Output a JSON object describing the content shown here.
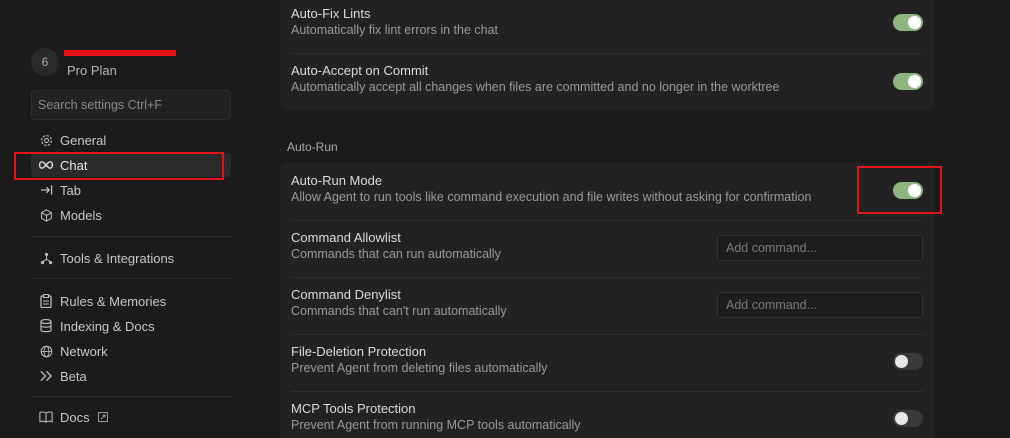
{
  "profile": {
    "avatar_initial": "6",
    "name": "",
    "plan": "Pro Plan"
  },
  "search": {
    "placeholder": "Search settings Ctrl+F"
  },
  "sidebar": {
    "items": [
      {
        "label": "General",
        "icon": "gear-icon"
      },
      {
        "label": "Chat",
        "icon": "infinity-icon",
        "active": true
      },
      {
        "label": "Tab",
        "icon": "tab-arrow-icon"
      },
      {
        "label": "Models",
        "icon": "cube-icon"
      },
      {
        "label": "Tools & Integrations",
        "icon": "tools-icon"
      },
      {
        "label": "Rules & Memories",
        "icon": "clipboard-icon"
      },
      {
        "label": "Indexing & Docs",
        "icon": "database-icon"
      },
      {
        "label": "Network",
        "icon": "globe-icon"
      },
      {
        "label": "Beta",
        "icon": "double-chevron-icon"
      },
      {
        "label": "Docs",
        "icon": "book-icon"
      }
    ]
  },
  "top_card": {
    "rows": [
      {
        "title": "Auto-Fix Lints",
        "desc": "Automatically fix lint errors in the chat",
        "toggle": "on"
      },
      {
        "title": "Auto-Accept on Commit",
        "desc": "Automatically accept all changes when files are committed and no longer in the worktree",
        "toggle": "on"
      }
    ]
  },
  "auto_run": {
    "section_label": "Auto-Run",
    "rows": [
      {
        "title": "Auto-Run Mode",
        "desc": "Allow Agent to run tools like command execution and file writes without asking for confirmation",
        "toggle": "on"
      },
      {
        "title": "Command Allowlist",
        "desc": "Commands that can run automatically",
        "input_placeholder": "Add command..."
      },
      {
        "title": "Command Denylist",
        "desc": "Commands that can't run automatically",
        "input_placeholder": "Add command..."
      },
      {
        "title": "File-Deletion Protection",
        "desc": "Prevent Agent from deleting files automatically",
        "toggle": "off"
      },
      {
        "title": "MCP Tools Protection",
        "desc": "Prevent Agent from running MCP tools automatically",
        "toggle": "off"
      }
    ]
  },
  "colors": {
    "toggle_on": "#8fb680",
    "highlight": "#e3141c",
    "background": "#1b1b1b",
    "card": "#222222"
  }
}
